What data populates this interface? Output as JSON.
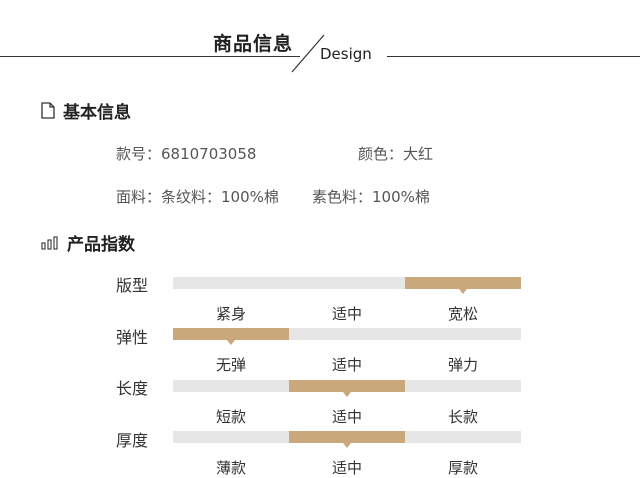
{
  "header": {
    "title": "商品信息",
    "subtitle": "Design"
  },
  "basic": {
    "title": "基本信息",
    "style_no": "款号：6810703058",
    "color": "颜色：大红",
    "fabric": "面料：条纹料：100%棉",
    "plain": "素色料：100%棉"
  },
  "index": {
    "title": "产品指数",
    "rows": [
      {
        "label": "版型",
        "options": [
          "紧身",
          "适中",
          "宽松"
        ],
        "selected": 2
      },
      {
        "label": "弹性",
        "options": [
          "无弹",
          "适中",
          "弹力"
        ],
        "selected": 0
      },
      {
        "label": "长度",
        "options": [
          "短款",
          "适中",
          "长款"
        ],
        "selected": 1
      },
      {
        "label": "厚度",
        "options": [
          "薄款",
          "适中",
          "厚款"
        ],
        "selected": 1
      }
    ]
  },
  "colors": {
    "accent": "#c9a87c",
    "track": "#e6e6e6"
  }
}
